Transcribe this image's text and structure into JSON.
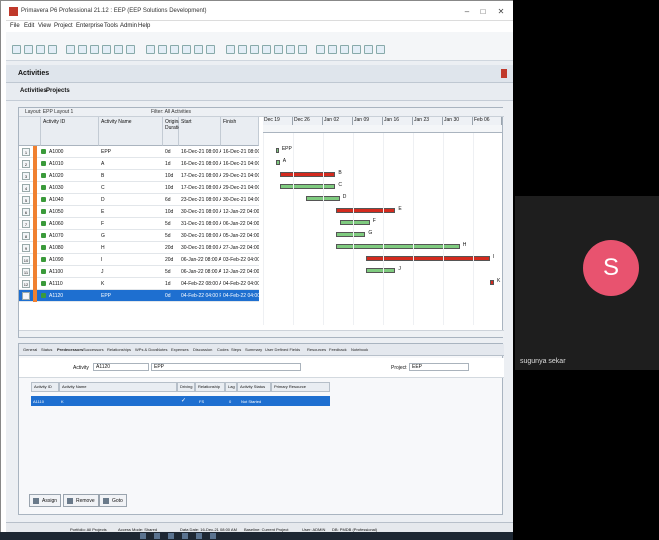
{
  "window": {
    "title": "Primavera P6 Professional 21.12 : EEP (EEP Solutions Development)",
    "accent": "#c0392b"
  },
  "menu": [
    "File",
    "Edit",
    "View",
    "Project",
    "Enterprise",
    "Tools",
    "Admin",
    "Help"
  ],
  "section": {
    "title": "Activities"
  },
  "tabs": [
    "Activities",
    "Projects"
  ],
  "layout": {
    "name": "Layout: EPP Layout 1",
    "filter": "Filter: All Activities"
  },
  "columns": [
    "Activity ID",
    "Activity Name",
    "Original Duration",
    "Start",
    "Finish"
  ],
  "rows": [
    {
      "num": "1",
      "id": "A1000",
      "name": "EPP",
      "dur": "0d",
      "start": "16-Dec-21 08:00 AM",
      "finish": "16-Dec-21 08:00 AM"
    },
    {
      "num": "2",
      "id": "A1010",
      "name": "A",
      "dur": "1d",
      "start": "16-Dec-21 08:00 AM",
      "finish": "16-Dec-21 04:00 PM"
    },
    {
      "num": "3",
      "id": "A1020",
      "name": "B",
      "dur": "10d",
      "start": "17-Dec-21 08:00 AM",
      "finish": "29-Dec-21 04:00 PM"
    },
    {
      "num": "4",
      "id": "A1030",
      "name": "C",
      "dur": "10d",
      "start": "17-Dec-21 08:00 AM",
      "finish": "29-Dec-21 04:00 PM"
    },
    {
      "num": "5",
      "id": "A1040",
      "name": "D",
      "dur": "6d",
      "start": "23-Dec-21 08:00 AM",
      "finish": "30-Dec-21 04:00 PM"
    },
    {
      "num": "6",
      "id": "A1050",
      "name": "E",
      "dur": "10d",
      "start": "30-Dec-21 08:00 AM",
      "finish": "12-Jan-22 04:00 PM"
    },
    {
      "num": "7",
      "id": "A1060",
      "name": "F",
      "dur": "5d",
      "start": "31-Dec-21 08:00 AM",
      "finish": "06-Jan-22 04:00 PM"
    },
    {
      "num": "8",
      "id": "A1070",
      "name": "G",
      "dur": "5d",
      "start": "30-Dec-21 08:00 AM",
      "finish": "05-Jan-22 04:00 PM"
    },
    {
      "num": "9",
      "id": "A1080",
      "name": "H",
      "dur": "20d",
      "start": "30-Dec-21 08:00 AM",
      "finish": "27-Jan-22 04:00 PM"
    },
    {
      "num": "10",
      "id": "A1090",
      "name": "I",
      "dur": "20d",
      "start": "06-Jan-22 08:00 AM",
      "finish": "03-Feb-22 04:00 PM"
    },
    {
      "num": "11",
      "id": "A1100",
      "name": "J",
      "dur": "5d",
      "start": "06-Jan-22 08:00 AM",
      "finish": "12-Jan-22 04:00 PM"
    },
    {
      "num": "12",
      "id": "A1110",
      "name": "K",
      "dur": "1d",
      "start": "04-Feb-22 08:00 AM",
      "finish": "04-Feb-22 04:00 PM"
    },
    {
      "num": "13",
      "id": "A1120",
      "name": "EPP",
      "dur": "0d",
      "start": "04-Feb-22 04:00 PM",
      "finish": "04-Feb-22 04:00 PM"
    }
  ],
  "gantt_months": [
    "Dec 19",
    "Dec 26",
    "Jan 02",
    "Jan 09",
    "Jan 16",
    "Jan 23",
    "Jan 30",
    "Feb 06"
  ],
  "gantt_bars": [
    {
      "row": 0,
      "color": "green",
      "label": "EPP"
    },
    {
      "row": 1,
      "color": "green",
      "label": "A"
    },
    {
      "row": 2,
      "color": "red",
      "label": "B"
    },
    {
      "row": 3,
      "color": "green",
      "label": "C"
    },
    {
      "row": 4,
      "color": "green",
      "label": "D"
    },
    {
      "row": 5,
      "color": "red",
      "label": "E"
    },
    {
      "row": 6,
      "color": "green",
      "label": "F"
    },
    {
      "row": 7,
      "color": "green",
      "label": "G"
    },
    {
      "row": 8,
      "color": "green",
      "label": "H"
    },
    {
      "row": 9,
      "color": "red",
      "label": "I"
    },
    {
      "row": 10,
      "color": "green",
      "label": "J"
    },
    {
      "row": 11,
      "color": "red",
      "label": "K"
    }
  ],
  "detail_tabs": [
    "General",
    "Status",
    "Predecessors",
    "Successors",
    "Relationships",
    "WPs & Docs",
    "Notes",
    "Expenses",
    "Discussion",
    "Codes",
    "Steps",
    "Summary",
    "User Defined Fields",
    "Resources",
    "Feedback",
    "Notebook"
  ],
  "detail": {
    "activity_label": "Activity",
    "activity_id": "A1120",
    "activity_name": "EPP",
    "project_label": "Project",
    "project_value": "EEP"
  },
  "pred_columns": [
    "Activity ID",
    "Activity Name",
    "Driving",
    "Relationship",
    "Lag",
    "Activity Status",
    "Primary Resource"
  ],
  "pred_row": {
    "id": "A1110",
    "name": "K",
    "driving": "✓",
    "rel": "FS",
    "lag": "0",
    "status": "Not Started",
    "resource": ""
  },
  "buttons": [
    "Assign",
    "Remove",
    "Goto"
  ],
  "status_bar": {
    "portfolio": "Portfolio: All Projects",
    "access": "Access Mode: Shared",
    "data_date": "Data Date: 16-Dec-21 08:00 AM",
    "baseline": "Baseline: Current Project",
    "user": "User: ADMIN",
    "db": "DB: PMDB (Professional)"
  },
  "participant": {
    "initial": "S",
    "name": "sugunya sekar"
  },
  "window_controls": {
    "minimize": "–",
    "maximize": "□",
    "close": "✕"
  }
}
